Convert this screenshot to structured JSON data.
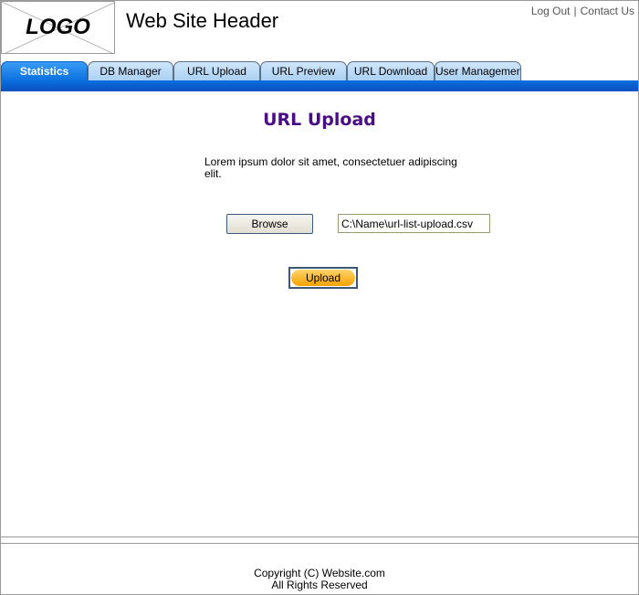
{
  "header": {
    "logo_text": "LOGO",
    "site_title": "Web Site Header",
    "links": {
      "logout": "Log Out",
      "separator": "|",
      "contact": "Contact Us"
    }
  },
  "tabs": [
    {
      "label": "Statistics",
      "active": true
    },
    {
      "label": "DB Manager",
      "active": false
    },
    {
      "label": "URL Upload",
      "active": false
    },
    {
      "label": "URL Preview",
      "active": false
    },
    {
      "label": "URL Download",
      "active": false
    },
    {
      "label": "User Management",
      "active": false
    }
  ],
  "main": {
    "title": "URL Upload",
    "description": "Lorem ipsum dolor sit amet, consectetuer adipiscing elit.",
    "browse_label": "Browse",
    "file_value": "C:\\Name\\url-list-upload.csv",
    "upload_label": "Upload"
  },
  "footer": {
    "copyright": "Copyright (C) Website.com",
    "rights": "All Rights Reserved"
  },
  "colors": {
    "accent": "#0a6fde",
    "title": "#4b0d86",
    "upload": "#f6a200"
  }
}
